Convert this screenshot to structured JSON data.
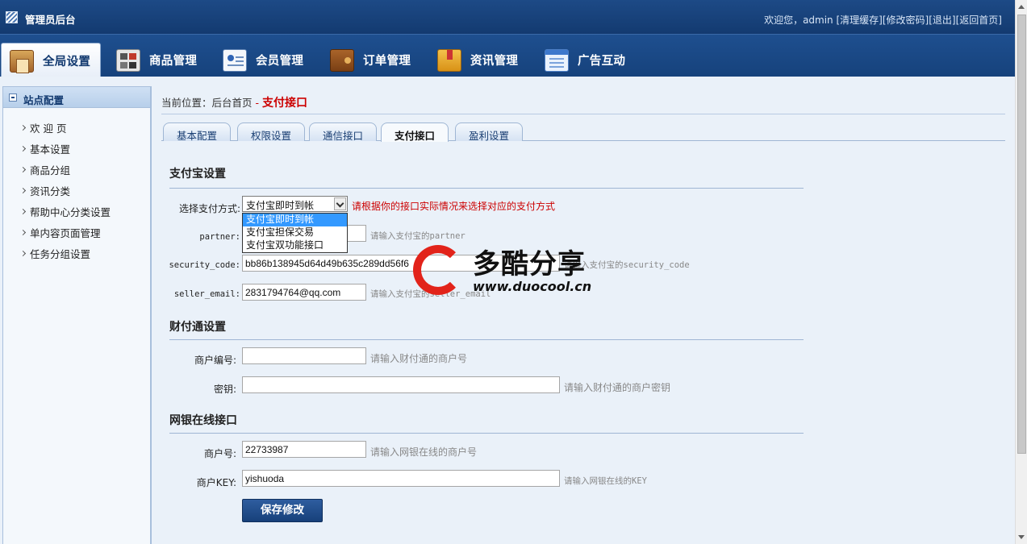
{
  "header": {
    "title": "管理员后台",
    "welcome": "欢迎您，admin",
    "links": [
      "[清理缓存]",
      "[修改密码]",
      "[退出]",
      "[返回首页]"
    ]
  },
  "nav": {
    "items": [
      {
        "label": "全局设置",
        "icon": "home-settings-icon"
      },
      {
        "label": "商品管理",
        "icon": "goods-grid-icon"
      },
      {
        "label": "会员管理",
        "icon": "member-card-icon"
      },
      {
        "label": "订单管理",
        "icon": "wallet-icon"
      },
      {
        "label": "资讯管理",
        "icon": "news-bookmark-icon"
      },
      {
        "label": "广告互动",
        "icon": "ad-window-icon"
      }
    ],
    "active_index": 0
  },
  "sidebar": {
    "title": "站点配置",
    "items": [
      "欢 迎 页",
      "基本设置",
      "商品分组",
      "资讯分类",
      "帮助中心分类设置",
      "单内容页面管理",
      "任务分组设置"
    ]
  },
  "breadcrumb": {
    "prefix": "当前位置：",
    "home": "后台首页",
    "separator": "-",
    "current": "支付接口"
  },
  "tabs": {
    "items": [
      "基本配置",
      "权限设置",
      "通信接口",
      "支付接口",
      "盈利设置"
    ],
    "active_index": 3
  },
  "alipay": {
    "section_title": "支付宝设置",
    "method_label": "选择支付方式:",
    "method_selected": "支付宝即时到帐",
    "method_options": [
      "支付宝即时到帐",
      "支付宝担保交易",
      "支付宝双功能接口"
    ],
    "method_hint": "请根据你的接口实际情况来选择对应的支付方式",
    "partner_label": "partner:",
    "partner_value": "",
    "partner_hint": "请输入支付宝的partner",
    "security_label": "security_code:",
    "security_value": "bb86b138945d64d49b635c289dd56f6",
    "security_hint": "请输入支付宝的security_code",
    "email_label": "seller_email:",
    "email_value": "2831794764@qq.com",
    "email_hint": "请输入支付宝的seller_email"
  },
  "tenpay": {
    "section_title": "财付通设置",
    "merchant_label": "商户编号:",
    "merchant_value": "",
    "merchant_hint": "请输入财付通的商户号",
    "key_label": "密钥:",
    "key_value": "",
    "key_hint": "请输入财付通的商户密钥"
  },
  "chinabank": {
    "section_title": "网银在线接口",
    "merchant_label": "商户号:",
    "merchant_value": "22733987",
    "merchant_hint": "请输入网银在线的商户号",
    "key_label": "商户KEY:",
    "key_value": "yishuoda",
    "key_hint": "请输入网银在线的KEY"
  },
  "save_label": "保存修改",
  "watermark": {
    "name": "多酷分享",
    "url": "www.duocool.cn"
  },
  "colors": {
    "header_blue": "#1d4a86",
    "accent_red": "#cc0000",
    "page_bg": "#eaf1f9",
    "selected_option": "#3399ff"
  }
}
